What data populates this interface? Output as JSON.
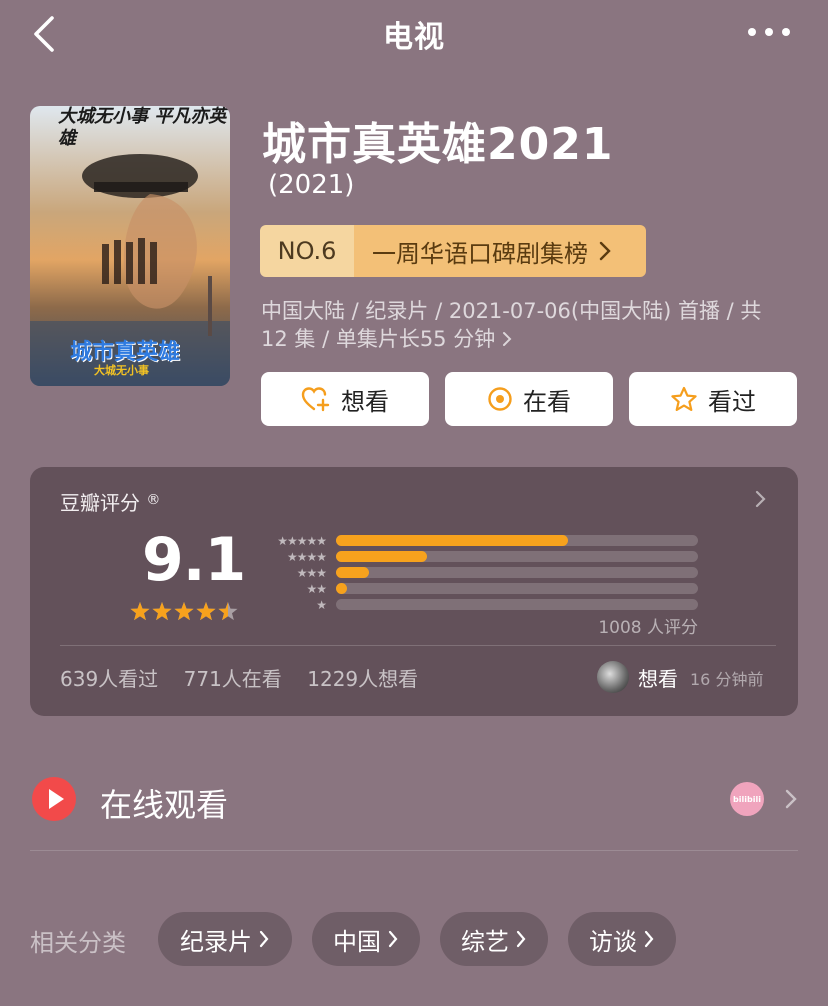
{
  "nav": {
    "title": "电视"
  },
  "poster": {
    "top_text": "大城无小事 平凡亦英雄",
    "logo_text": "城市真英雄",
    "logo_sub": "大城无小事"
  },
  "show": {
    "title": "城市真英雄2021",
    "year": "(2021)",
    "rank_no": "NO.6",
    "rank_label": "一周华语口碑剧集榜",
    "meta": "中国大陆 / 纪录片 / 2021-07-06(中国大陆) 首播 / 共 12 集 / 单集片长55 分钟"
  },
  "actions": [
    {
      "label": "想看",
      "icon": "heart-plus-icon"
    },
    {
      "label": "在看",
      "icon": "target-icon"
    },
    {
      "label": "看过",
      "icon": "star-outline-icon"
    }
  ],
  "rating": {
    "title": "豆瓣评分",
    "score": "9.1",
    "stars_value": 4.5,
    "distribution": [
      {
        "stars": 5,
        "fraction": 0.64
      },
      {
        "stars": 4,
        "fraction": 0.25
      },
      {
        "stars": 3,
        "fraction": 0.09
      },
      {
        "stars": 2,
        "fraction": 0.03
      },
      {
        "stars": 1,
        "fraction": 0.0
      }
    ],
    "count": "1008 人评分",
    "watched": "639人看过",
    "watching": "771人在看",
    "want": "1229人想看",
    "friend_action": "想看",
    "friend_time": "16 分钟前"
  },
  "online": {
    "label": "在线观看",
    "provider": "bilibili"
  },
  "tags": {
    "label": "相关分类",
    "items": [
      "纪录片",
      "中国",
      "综艺",
      "访谈"
    ]
  },
  "colors": {
    "accent": "#f7a21d",
    "background": "#8a7580",
    "play_red": "#f24a4a"
  }
}
